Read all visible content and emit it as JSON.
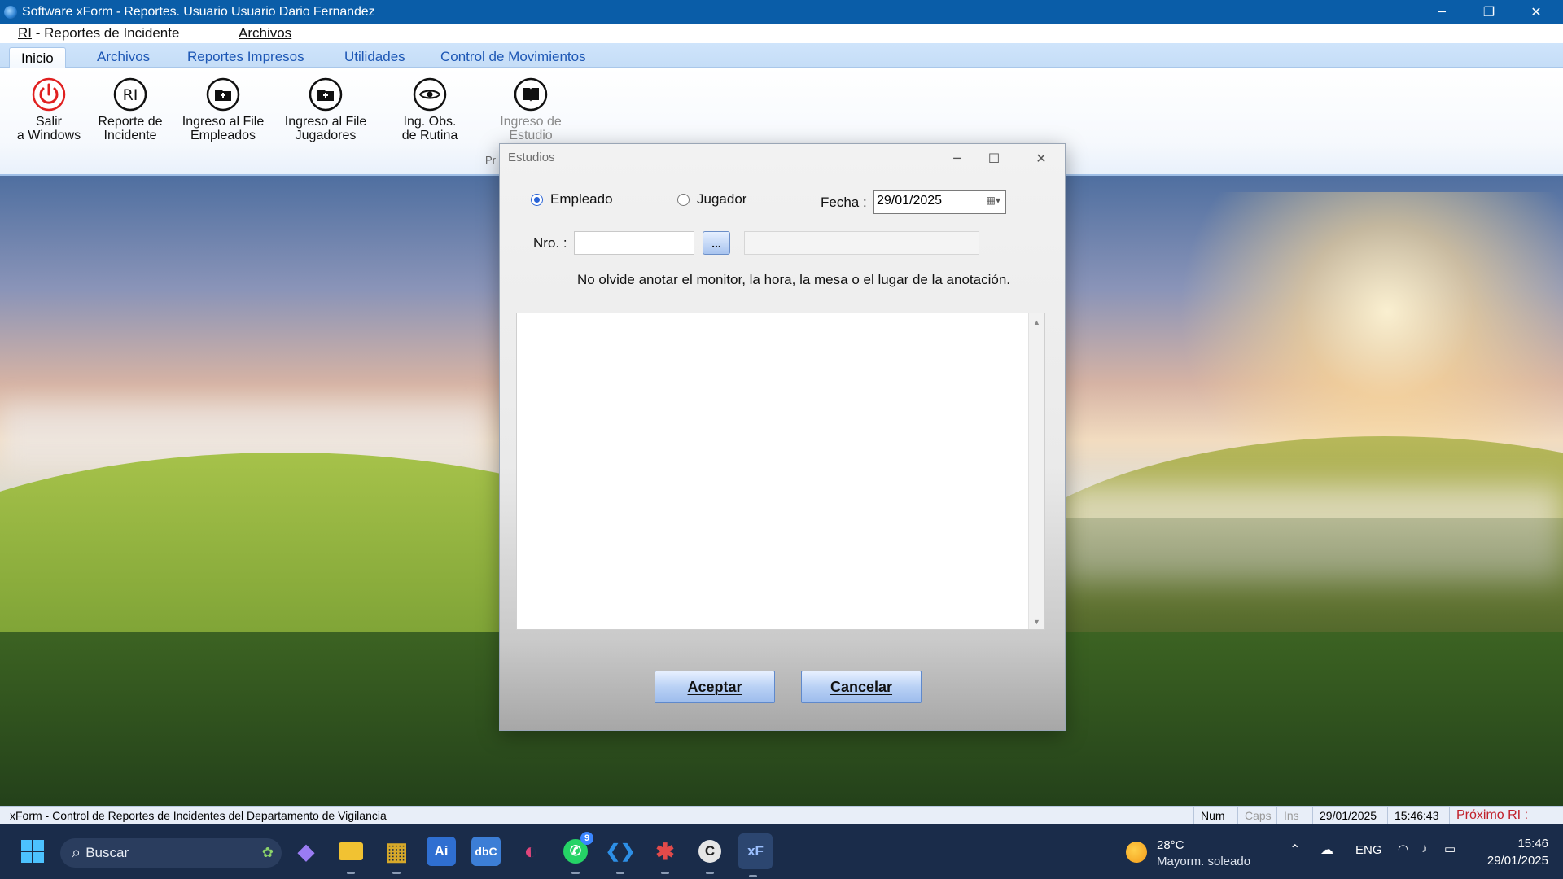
{
  "window": {
    "title": "Software xForm - Reportes.  Usuario Usuario Dario Fernandez",
    "controls": {
      "minimize": "─",
      "restore": "❐",
      "close": "✕"
    }
  },
  "menu": {
    "items": [
      {
        "prefix": "RI",
        "label": " - Reportes de Incidente"
      },
      {
        "label": "Archivos"
      }
    ]
  },
  "ribbon": {
    "tabs": [
      "Inicio",
      "Archivos",
      "Reportes Impresos",
      "Utilidades",
      "Control de Movimientos"
    ],
    "active_tab": "Inicio",
    "buttons": [
      {
        "line1": "Salir",
        "line2": "a Windows",
        "icon": "power-icon",
        "color": "#e02020"
      },
      {
        "line1": "Reporte de",
        "line2": "Incidente",
        "icon": "ri-icon"
      },
      {
        "line1": "Ingreso al File",
        "line2": "Empleados",
        "icon": "folder-icon"
      },
      {
        "line1": "Ingreso al File",
        "line2": "Jugadores",
        "icon": "folder-icon"
      },
      {
        "line1": "Ing. Obs.",
        "line2": "de Rutina",
        "icon": "eye-icon"
      },
      {
        "line1": "Ingreso de",
        "line2": "Estudio",
        "icon": "book-icon",
        "disabled": true
      }
    ],
    "group_label": "Pr"
  },
  "dialog": {
    "title": "Estudios",
    "controls": {
      "minimize": "─",
      "maximize": "☐",
      "close": "✕"
    },
    "radio_empleado": "Empleado",
    "radio_jugador": "Jugador",
    "selected": "Empleado",
    "fecha_label": "Fecha :",
    "fecha_value": "29/01/2025",
    "nro_label": "Nro. :",
    "nro_value": "",
    "browse_label": "...",
    "name_value": "",
    "hint": "No olvide anotar el monitor, la hora, la mesa o el lugar de la anotación.",
    "memo_value": "",
    "accept_label": "Aceptar",
    "cancel_label": "Cancelar"
  },
  "statusbar": {
    "text": "xForm - Control de Reportes de Incidentes del Departamento de  Vigilancia",
    "num": "Num",
    "caps": "Caps",
    "ins": "Ins",
    "date": "29/01/2025",
    "time": "15:46:43",
    "proximo": "Próximo RI :",
    "proximo_color": "#c0202a"
  },
  "taskbar": {
    "search_placeholder": "Buscar",
    "whatsapp_badge": "9",
    "weather_temp": "28°C",
    "weather_desc": "Mayorm. soleado",
    "language": "ENG",
    "clock_time": "15:46",
    "clock_date": "29/01/2025",
    "apps": [
      {
        "name": "copilot-icon",
        "glyph": "◆",
        "color": "#7a6cf0"
      },
      {
        "name": "file-explorer-icon",
        "glyph": "▬",
        "color": "#f1c232"
      },
      {
        "name": "app-grid-icon",
        "glyph": "▦",
        "color": "#d7a92a"
      },
      {
        "name": "ai-app-icon",
        "glyph": "Ai",
        "color": "#3a7be0"
      },
      {
        "name": "dbc-app-icon",
        "glyph": "dbC",
        "color": "#4b8ee6"
      },
      {
        "name": "arc-app-icon",
        "glyph": "◐",
        "color": "#e0457b"
      },
      {
        "name": "whatsapp-icon",
        "glyph": "✆",
        "color": "#25d366"
      },
      {
        "name": "vscode-icon",
        "glyph": "❮❯",
        "color": "#2d8fe6"
      },
      {
        "name": "star-app-icon",
        "glyph": "✱",
        "color": "#e24a4a"
      },
      {
        "name": "c-app-icon",
        "glyph": "C",
        "color": "#d9d9d9"
      },
      {
        "name": "xform-app-icon",
        "glyph": "xF",
        "color": "#5d8fe0"
      }
    ]
  }
}
